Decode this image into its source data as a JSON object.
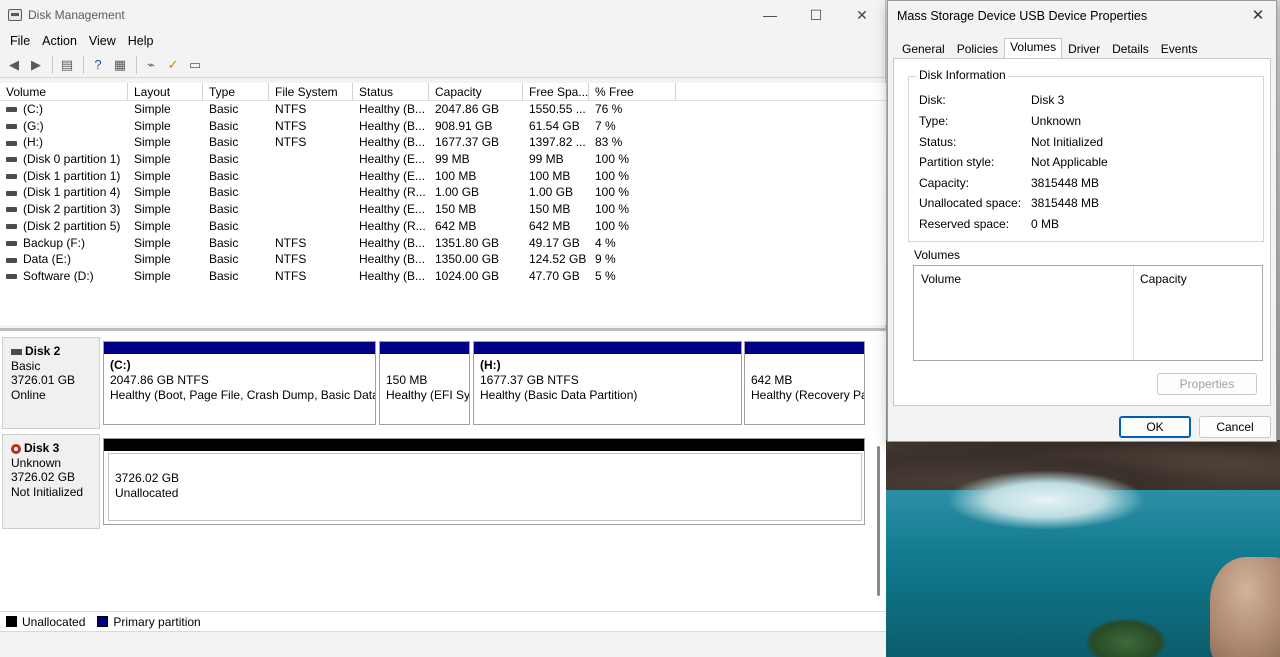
{
  "dm": {
    "title": "Disk Management",
    "window_controls": {
      "minimize": "—",
      "maximize": "☐",
      "close": "✕"
    },
    "menu": [
      "File",
      "Action",
      "View",
      "Help"
    ],
    "columns": [
      "Volume",
      "Layout",
      "Type",
      "File System",
      "Status",
      "Capacity",
      "Free Spa...",
      "% Free"
    ],
    "volumes": [
      {
        "icon": "drive-icon",
        "volume": "(C:)",
        "layout": "Simple",
        "type": "Basic",
        "fs": "NTFS",
        "status": "Healthy (B...",
        "capacity": "2047.86 GB",
        "free": "1550.55 ...",
        "pct": "76 %"
      },
      {
        "icon": "drive-icon",
        "volume": "(G:)",
        "layout": "Simple",
        "type": "Basic",
        "fs": "NTFS",
        "status": "Healthy (B...",
        "capacity": "908.91 GB",
        "free": "61.54 GB",
        "pct": "7 %"
      },
      {
        "icon": "drive-icon",
        "volume": "(H:)",
        "layout": "Simple",
        "type": "Basic",
        "fs": "NTFS",
        "status": "Healthy (B...",
        "capacity": "1677.37 GB",
        "free": "1397.82 ...",
        "pct": "83 %"
      },
      {
        "icon": "drive-icon",
        "volume": "(Disk 0 partition 1)",
        "layout": "Simple",
        "type": "Basic",
        "fs": "",
        "status": "Healthy (E...",
        "capacity": "99 MB",
        "free": "99 MB",
        "pct": "100 %"
      },
      {
        "icon": "drive-icon",
        "volume": "(Disk 1 partition 1)",
        "layout": "Simple",
        "type": "Basic",
        "fs": "",
        "status": "Healthy (E...",
        "capacity": "100 MB",
        "free": "100 MB",
        "pct": "100 %"
      },
      {
        "icon": "drive-icon",
        "volume": "(Disk 1 partition 4)",
        "layout": "Simple",
        "type": "Basic",
        "fs": "",
        "status": "Healthy (R...",
        "capacity": "1.00 GB",
        "free": "1.00 GB",
        "pct": "100 %"
      },
      {
        "icon": "drive-icon",
        "volume": "(Disk 2 partition 3)",
        "layout": "Simple",
        "type": "Basic",
        "fs": "",
        "status": "Healthy (E...",
        "capacity": "150 MB",
        "free": "150 MB",
        "pct": "100 %"
      },
      {
        "icon": "drive-icon",
        "volume": "(Disk 2 partition 5)",
        "layout": "Simple",
        "type": "Basic",
        "fs": "",
        "status": "Healthy (R...",
        "capacity": "642 MB",
        "free": "642 MB",
        "pct": "100 %"
      },
      {
        "icon": "drive-icon",
        "volume": "Backup (F:)",
        "layout": "Simple",
        "type": "Basic",
        "fs": "NTFS",
        "status": "Healthy (B...",
        "capacity": "1351.80 GB",
        "free": "49.17 GB",
        "pct": "4 %"
      },
      {
        "icon": "drive-icon",
        "volume": "Data (E:)",
        "layout": "Simple",
        "type": "Basic",
        "fs": "NTFS",
        "status": "Healthy (B...",
        "capacity": "1350.00 GB",
        "free": "124.52 GB",
        "pct": "9 %"
      },
      {
        "icon": "drive-icon",
        "volume": "Software (D:)",
        "layout": "Simple",
        "type": "Basic",
        "fs": "NTFS",
        "status": "Healthy (B...",
        "capacity": "1024.00 GB",
        "free": "47.70 GB",
        "pct": "5 %"
      }
    ],
    "disk2": {
      "name": "Disk 2",
      "type": "Basic",
      "size": "3726.01 GB",
      "status": "Online",
      "partitions": [
        {
          "title": "(C:)",
          "line1": "2047.86 GB NTFS",
          "line2": "Healthy (Boot, Page File, Crash Dump, Basic Data F"
        },
        {
          "title": "",
          "line1": "150 MB",
          "line2": "Healthy (EFI Sys"
        },
        {
          "title": "(H:)",
          "line1": "1677.37 GB NTFS",
          "line2": "Healthy (Basic Data Partition)"
        },
        {
          "title": "",
          "line1": "642 MB",
          "line2": "Healthy (Recovery Pa"
        }
      ]
    },
    "disk3": {
      "name": "Disk 3",
      "type": "Unknown",
      "size": "3726.02 GB",
      "status": "Not Initialized",
      "unallocated": {
        "line1": "3726.02 GB",
        "line2": "Unallocated"
      }
    },
    "legend": [
      {
        "label": "Unallocated",
        "color": "#000000"
      },
      {
        "label": "Primary partition",
        "color": "#000084"
      }
    ]
  },
  "props": {
    "title": "Mass Storage Device USB Device Properties",
    "tabs": [
      "General",
      "Policies",
      "Volumes",
      "Driver",
      "Details",
      "Events"
    ],
    "active_tab": "Volumes",
    "group_title": "Disk Information",
    "info": [
      {
        "label": "Disk:",
        "value": "Disk 3"
      },
      {
        "label": "Type:",
        "value": "Unknown"
      },
      {
        "label": "Status:",
        "value": "Not Initialized"
      },
      {
        "label": "Partition style:",
        "value": "Not Applicable"
      },
      {
        "label": "Capacity:",
        "value": "3815448 MB"
      },
      {
        "label": "Unallocated space:",
        "value": "3815448 MB"
      },
      {
        "label": "Reserved space:",
        "value": "0 MB"
      }
    ],
    "volumes_label": "Volumes",
    "vol_columns": [
      "Volume",
      "Capacity"
    ],
    "properties_button": "Properties",
    "ok": "OK",
    "cancel": "Cancel"
  }
}
